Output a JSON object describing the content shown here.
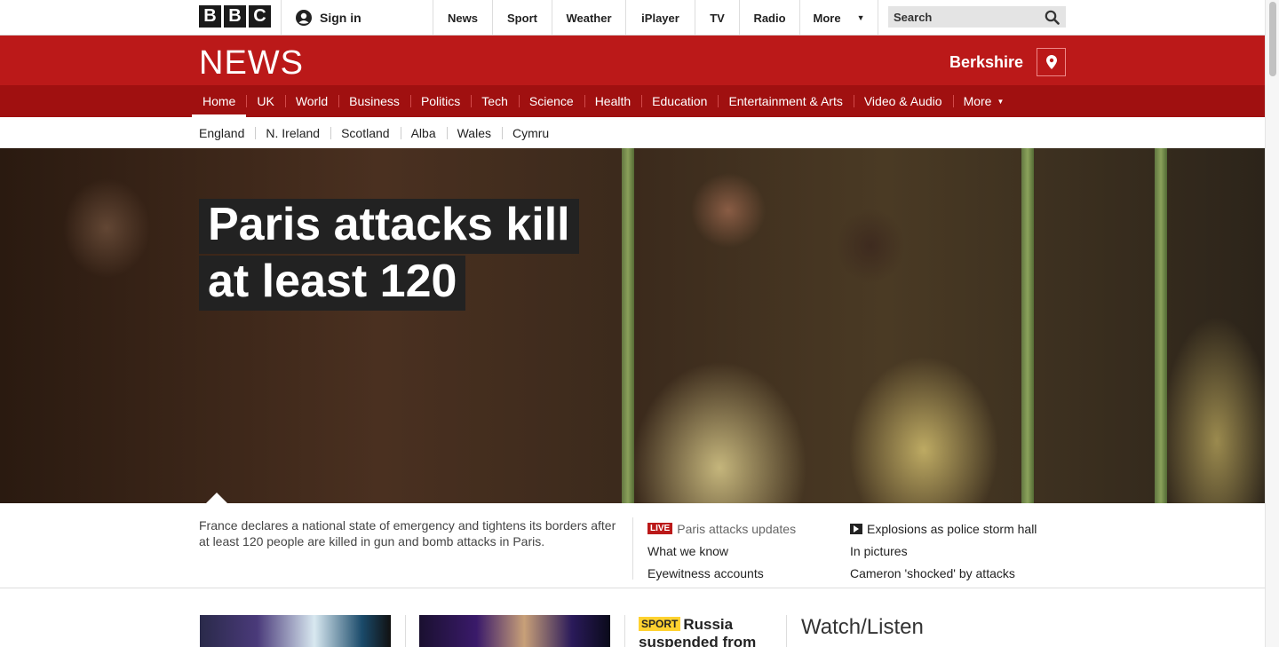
{
  "brand": {
    "letters": [
      "B",
      "B",
      "C"
    ]
  },
  "global_nav": {
    "sign_in": "Sign in",
    "items": [
      {
        "label": "News",
        "width": 67
      },
      {
        "label": "Sport",
        "width": 67
      },
      {
        "label": "Weather",
        "width": 83
      },
      {
        "label": "iPlayer",
        "width": 78
      },
      {
        "label": "TV",
        "width": 50
      },
      {
        "label": "Radio",
        "width": 68
      },
      {
        "label": "More",
        "width": 88
      }
    ],
    "search_placeholder": "Search"
  },
  "masthead": {
    "logo": "NEWS",
    "location": "Berkshire"
  },
  "primary_nav": [
    "Home",
    "UK",
    "World",
    "Business",
    "Politics",
    "Tech",
    "Science",
    "Health",
    "Education",
    "Entertainment & Arts",
    "Video & Audio",
    "More"
  ],
  "secondary_nav": [
    "England",
    "N. Ireland",
    "Scotland",
    "Alba",
    "Wales",
    "Cymru"
  ],
  "hero": {
    "headline": "Paris attacks kill at least 120",
    "summary": "France declares a national state of emergency and tightens its borders after at least 120 people are killed in gun and bomb attacks in Paris.",
    "related_col1": [
      {
        "badge": "LIVE",
        "label": "Paris attacks updates"
      },
      {
        "label": "What we know"
      },
      {
        "label": "Eyewitness accounts"
      }
    ],
    "related_col2": [
      {
        "label": "Explosions as police storm hall"
      },
      {
        "label": "In pictures"
      },
      {
        "label": "Cameron 'shocked' by attacks"
      }
    ]
  },
  "promos": {
    "sport_badge": "SPORT",
    "sport_headline": "Russia suspended from",
    "watch_listen": "Watch/Listen"
  },
  "colors": {
    "bbc_red": "#bb1919",
    "nav_red": "#a01010",
    "sport_yellow": "#ffd230"
  }
}
